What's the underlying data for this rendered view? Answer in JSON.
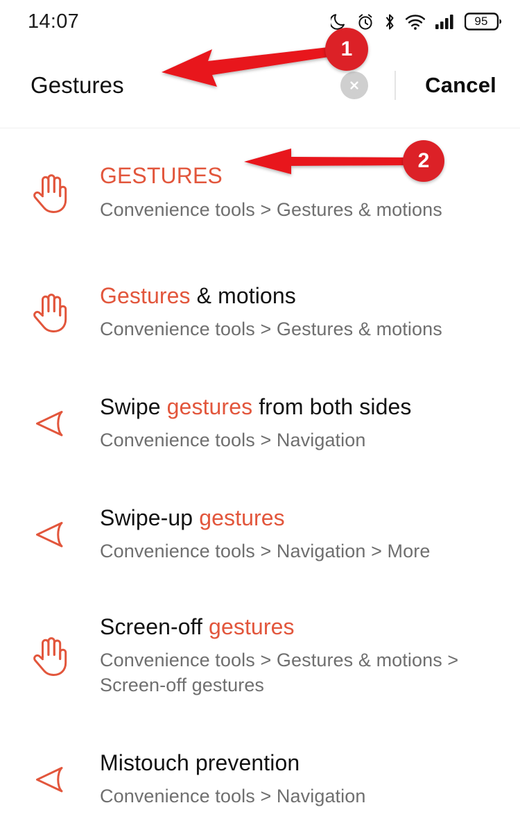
{
  "status_bar": {
    "time": "14:07",
    "battery_level": "95",
    "icons": [
      "dnd-moon-icon",
      "alarm-clock-icon",
      "bluetooth-icon",
      "wifi-icon",
      "cellular-signal-icon",
      "battery-icon"
    ]
  },
  "header": {
    "query": "Gestures",
    "clear_label": "×",
    "cancel_label": "Cancel"
  },
  "results": [
    {
      "icon": "hand-icon",
      "title_parts": [
        {
          "text": "GESTURES",
          "highlight": true
        }
      ],
      "subtitle": "Convenience tools > Gestures & motions"
    },
    {
      "icon": "hand-icon",
      "title_parts": [
        {
          "text": "Gestures",
          "highlight": true
        },
        {
          "text": " & motions",
          "highlight": false
        }
      ],
      "subtitle": "Convenience tools > Gestures & motions"
    },
    {
      "icon": "back-triangle-icon",
      "title_parts": [
        {
          "text": "Swipe ",
          "highlight": false
        },
        {
          "text": "gestures",
          "highlight": true
        },
        {
          "text": " from both sides",
          "highlight": false
        }
      ],
      "subtitle": "Convenience tools > Navigation"
    },
    {
      "icon": "back-triangle-icon",
      "title_parts": [
        {
          "text": "Swipe-up ",
          "highlight": false
        },
        {
          "text": "gestures",
          "highlight": true
        }
      ],
      "subtitle": "Convenience tools > Navigation > More"
    },
    {
      "icon": "hand-icon",
      "title_parts": [
        {
          "text": "Screen-off ",
          "highlight": false
        },
        {
          "text": "gestures",
          "highlight": true
        }
      ],
      "subtitle": "Convenience tools > Gestures & motions > Screen-off gestures"
    },
    {
      "icon": "back-triangle-icon",
      "title_parts": [
        {
          "text": "Mistouch prevention",
          "highlight": false
        }
      ],
      "subtitle": "Convenience tools > Navigation"
    }
  ],
  "annotations": [
    {
      "label": "1"
    },
    {
      "label": "2"
    }
  ],
  "colors": {
    "highlight": "#e2563c",
    "subtitle": "#6f6f6f",
    "annotation_red": "#dc2127",
    "background": "#ffffff"
  }
}
